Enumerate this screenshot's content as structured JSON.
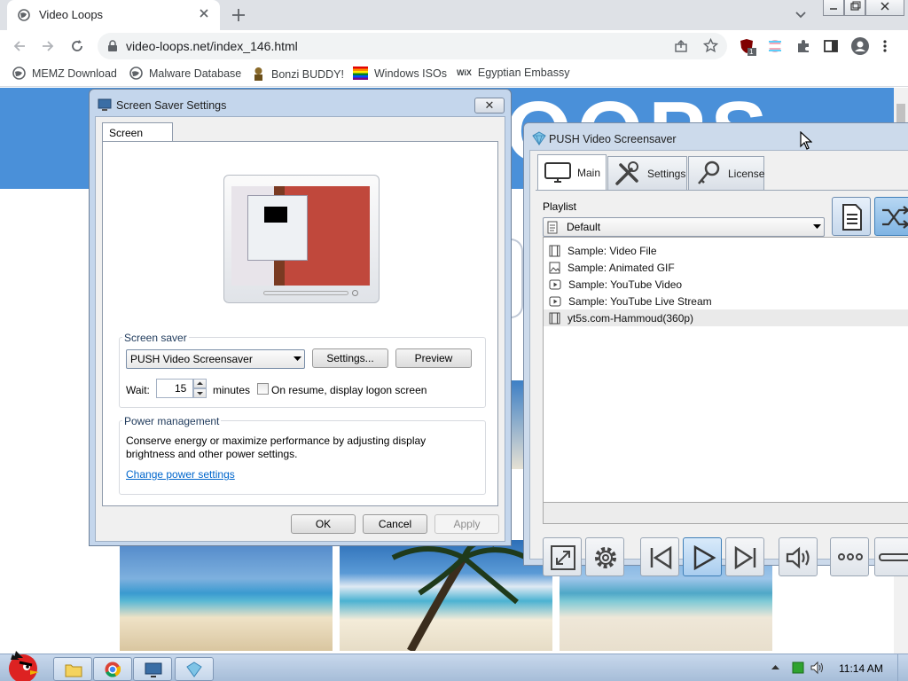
{
  "browser": {
    "tab_title": "Video Loops",
    "url": "video-loops.net/index_146.html",
    "bookmarks": [
      "MEMZ Download",
      "Malware Database",
      "Bonzi BUDDY!",
      "Windows ISOs",
      "Egyptian Embassy"
    ],
    "extension_badge": "1"
  },
  "page": {
    "banner_title_partial": "OOPS"
  },
  "screensaver_dialog": {
    "title": "Screen Saver Settings",
    "close": "✕",
    "tab": "Screen Saver",
    "screensaver_group": "Screen saver",
    "selected_screensaver": "PUSH Video Screensaver",
    "settings_button": "Settings...",
    "preview_button": "Preview",
    "wait_label": "Wait:",
    "wait_value": "15",
    "minutes_label": "minutes",
    "resume_label": "On resume, display logon screen",
    "resume_checked": false,
    "power_group": "Power management",
    "power_text": "Conserve energy or maximize performance by adjusting display brightness and other power settings.",
    "power_link": "Change power settings",
    "ok": "OK",
    "cancel": "Cancel",
    "apply": "Apply"
  },
  "push_window": {
    "title": "PUSH Video Screensaver",
    "tabs": [
      {
        "label": "Main",
        "icon": "monitor-icon"
      },
      {
        "label": "Settings",
        "icon": "tools-icon"
      },
      {
        "label": "License",
        "icon": "key-icon"
      }
    ],
    "playlist_label": "Playlist",
    "playlist_value": "Default",
    "items": [
      {
        "label": "Sample: Video File",
        "icon": "film-icon"
      },
      {
        "label": "Sample: Animated GIF",
        "icon": "image-icon"
      },
      {
        "label": "Sample: YouTube Video",
        "icon": "play-box-icon"
      },
      {
        "label": "Sample: YouTube Live Stream",
        "icon": "play-box-icon"
      },
      {
        "label": "yt5s.com-Hammoud(360p)",
        "icon": "film-icon"
      }
    ]
  },
  "taskbar": {
    "time": "11:14 AM"
  },
  "colors": {
    "accent_blue": "#4a90d9",
    "link": "#0066cc"
  }
}
